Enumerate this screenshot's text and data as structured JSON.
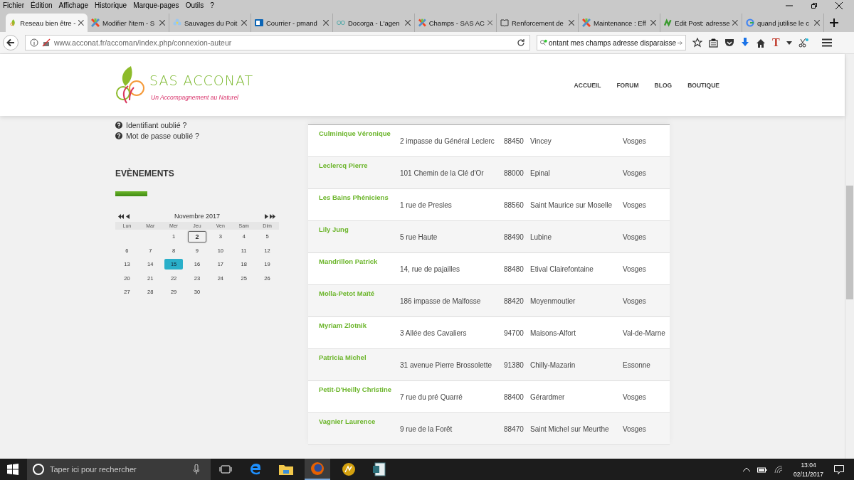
{
  "menu_bar": [
    "Fichier",
    "Édition",
    "Affichage",
    "Historique",
    "Marque-pages",
    "Outils",
    "?"
  ],
  "tabs": [
    {
      "label": "Reseau bien être -",
      "kind": "leaf",
      "selected": true
    },
    {
      "label": "Modifier l'item - S",
      "kind": "cross",
      "selected": false
    },
    {
      "label": "Sauvages du Poit",
      "kind": "flower",
      "selected": false
    },
    {
      "label": "Courrier - pmand",
      "kind": "mail",
      "selected": false
    },
    {
      "label": "Docorga - L'agen",
      "kind": "glasses",
      "selected": false
    },
    {
      "label": "Champs - SAS AC",
      "kind": "cross",
      "selected": false
    },
    {
      "label": "Renforcement de",
      "kind": "book",
      "selected": false
    },
    {
      "label": "Maintenance : Eff",
      "kind": "cross",
      "selected": false
    },
    {
      "label": "Edit Post: adresse",
      "kind": "wave",
      "selected": false
    },
    {
      "label": "quand jutilise le c",
      "kind": "ring",
      "selected": false
    }
  ],
  "address_bar": {
    "value": "www.acconat.fr/accoman/index.php/connexion-auteur"
  },
  "search_bar": {
    "value": "ontant mes champs adresse disparaisse"
  },
  "toolbar_text": "T",
  "site": {
    "brand": "SAS ACCONAT",
    "tagline": "Un Accompagnement au Naturel",
    "nav": [
      "ACCUEIL",
      "FORUM",
      "BLOG",
      "BOUTIQUE"
    ]
  },
  "account_links": [
    "Identifiant oublié ?",
    "Mot de passe oublié ?"
  ],
  "events": {
    "heading": "EVÈNEMENTS",
    "calendar": {
      "month": "Novembre 2017",
      "weekdays": [
        "Lun",
        "Mar",
        "Mer",
        "Jeu",
        "Ven",
        "Sam",
        "Dim"
      ],
      "weeks": [
        [
          {
            "d": "1",
            "today": false,
            "selected": false
          },
          {
            "d": "2",
            "today": true,
            "selected": false
          },
          {
            "d": "3",
            "today": false,
            "selected": false
          },
          {
            "d": "4",
            "today": false,
            "selected": false
          },
          {
            "d": "5",
            "today": false,
            "selected": false
          }
        ],
        [
          {
            "d": "6",
            "today": false,
            "selected": false
          },
          {
            "d": "7",
            "today": false,
            "selected": false
          },
          {
            "d": "8",
            "today": false,
            "selected": false
          },
          {
            "d": "9",
            "today": false,
            "selected": false
          },
          {
            "d": "10",
            "today": false,
            "selected": false
          },
          {
            "d": "11",
            "today": false,
            "selected": false
          },
          {
            "d": "12",
            "today": false,
            "selected": false
          }
        ],
        [
          {
            "d": "13",
            "today": false,
            "selected": false
          },
          {
            "d": "14",
            "today": false,
            "selected": false
          },
          {
            "d": "15",
            "today": false,
            "selected": true
          },
          {
            "d": "16",
            "today": false,
            "selected": false
          },
          {
            "d": "17",
            "today": false,
            "selected": false
          },
          {
            "d": "18",
            "today": false,
            "selected": false
          },
          {
            "d": "19",
            "today": false,
            "selected": false
          }
        ],
        [
          {
            "d": "20",
            "today": false,
            "selected": false
          },
          {
            "d": "21",
            "today": false,
            "selected": false
          },
          {
            "d": "22",
            "today": false,
            "selected": false
          },
          {
            "d": "23",
            "today": false,
            "selected": false
          },
          {
            "d": "24",
            "today": false,
            "selected": false
          },
          {
            "d": "25",
            "today": false,
            "selected": false
          },
          {
            "d": "26",
            "today": false,
            "selected": false
          }
        ],
        [
          {
            "d": "27",
            "today": false,
            "selected": false
          },
          {
            "d": "28",
            "today": false,
            "selected": false
          },
          {
            "d": "29",
            "today": false,
            "selected": false
          },
          {
            "d": "30",
            "today": false,
            "selected": false
          }
        ]
      ]
    }
  },
  "directory": [
    {
      "name": "Culminique Véronique",
      "street": "2 impasse du Général Leclerc",
      "postcode": "88450",
      "city": "Vincey",
      "department": "Vosges"
    },
    {
      "name": "Leclercq Pierre",
      "street": "101 Chemin de la Clé d'Or",
      "postcode": "88000",
      "city": "Epinal",
      "department": "Vosges"
    },
    {
      "name": "Les Bains Phéniciens",
      "street": "1 rue de Presles",
      "postcode": "88560",
      "city": "Saint Maurice sur Moselle",
      "department": "Vosges"
    },
    {
      "name": "Lily Jung",
      "street": "5 rue Haute",
      "postcode": "88490",
      "city": "Lubine",
      "department": "Vosges"
    },
    {
      "name": "Mandrillon Patrick",
      "street": "14, rue de pajailles",
      "postcode": "88480",
      "city": "Etival Clairefontaine",
      "department": "Vosges"
    },
    {
      "name": "Molla-Petot Maïté",
      "street": "186 impasse de Malfosse",
      "postcode": "88420",
      "city": "Moyenmoutier",
      "department": "Vosges"
    },
    {
      "name": "Myriam Zlotnik",
      "street": "3 Allée des Cavaliers",
      "postcode": "94700",
      "city": "Maisons-Alfort",
      "department": "Val-de-Marne"
    },
    {
      "name": "Patricia Michel",
      "street": "31 avenue Pierre Brossolette",
      "postcode": "91380",
      "city": "Chilly-Mazarin",
      "department": "Essonne"
    },
    {
      "name": "Petit-D'Heilly Christine",
      "street": "7 rue du pré Quarré",
      "postcode": "88400",
      "city": "Gérardmer",
      "department": "Vosges"
    },
    {
      "name": "Vagnier Laurence",
      "street": "9 rue de la Forêt",
      "postcode": "88470",
      "city": "Saint Michel sur Meurthe",
      "department": "Vosges"
    }
  ],
  "taskbar": {
    "search_placeholder": "Taper ici pour rechercher",
    "time": "13:04",
    "date": "02/11/2017"
  }
}
